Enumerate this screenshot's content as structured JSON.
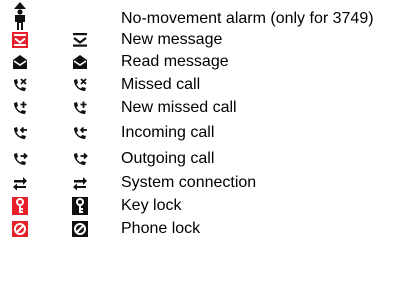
{
  "icon_legend": {
    "colors": {
      "accent_red": "#e8202a",
      "icon_black": "#111111"
    },
    "rows": [
      {
        "label": "No-movement alarm (only for 3749)",
        "color_icon": "man-down-icon",
        "mono_icon": null
      },
      {
        "label": "New message",
        "color_icon": "new-message-icon",
        "mono_icon": "new-message-icon"
      },
      {
        "label": "Read message",
        "color_icon": "read-message-icon",
        "mono_icon": "read-message-icon"
      },
      {
        "label": "Missed call",
        "color_icon": "missed-call-icon",
        "mono_icon": "missed-call-icon"
      },
      {
        "label": "New missed call",
        "color_icon": "new-missed-call-icon",
        "mono_icon": "new-missed-call-icon"
      },
      {
        "label": "Incoming call",
        "color_icon": "incoming-call-icon",
        "mono_icon": "incoming-call-icon"
      },
      {
        "label": "Outgoing call",
        "color_icon": "outgoing-call-icon",
        "mono_icon": "outgoing-call-icon"
      },
      {
        "label": "System connection",
        "color_icon": "system-connection-icon",
        "mono_icon": "system-connection-icon"
      },
      {
        "label": "Key lock",
        "color_icon": "key-lock-icon",
        "mono_icon": "key-lock-icon"
      },
      {
        "label": "Phone lock",
        "color_icon": "phone-lock-icon",
        "mono_icon": "phone-lock-icon"
      }
    ]
  }
}
